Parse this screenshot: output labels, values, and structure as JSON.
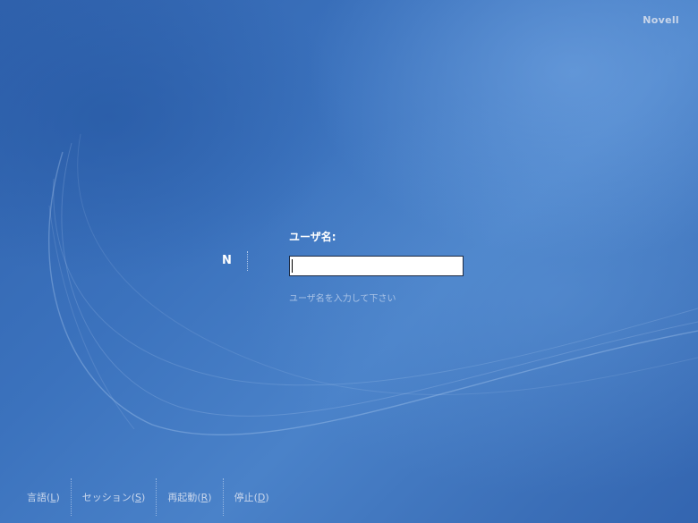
{
  "brand": {
    "name": "Novell"
  },
  "logo": {
    "letter": "N"
  },
  "login": {
    "label": "ユーザ名:",
    "value": "",
    "hint": "ユーザ名を入力して下さい"
  },
  "bottom_menu": [
    {
      "label": "言語",
      "mnemonic": "L"
    },
    {
      "label": "セッション",
      "mnemonic": "S"
    },
    {
      "label": "再起動",
      "mnemonic": "R"
    },
    {
      "label": "停止",
      "mnemonic": "D"
    }
  ]
}
